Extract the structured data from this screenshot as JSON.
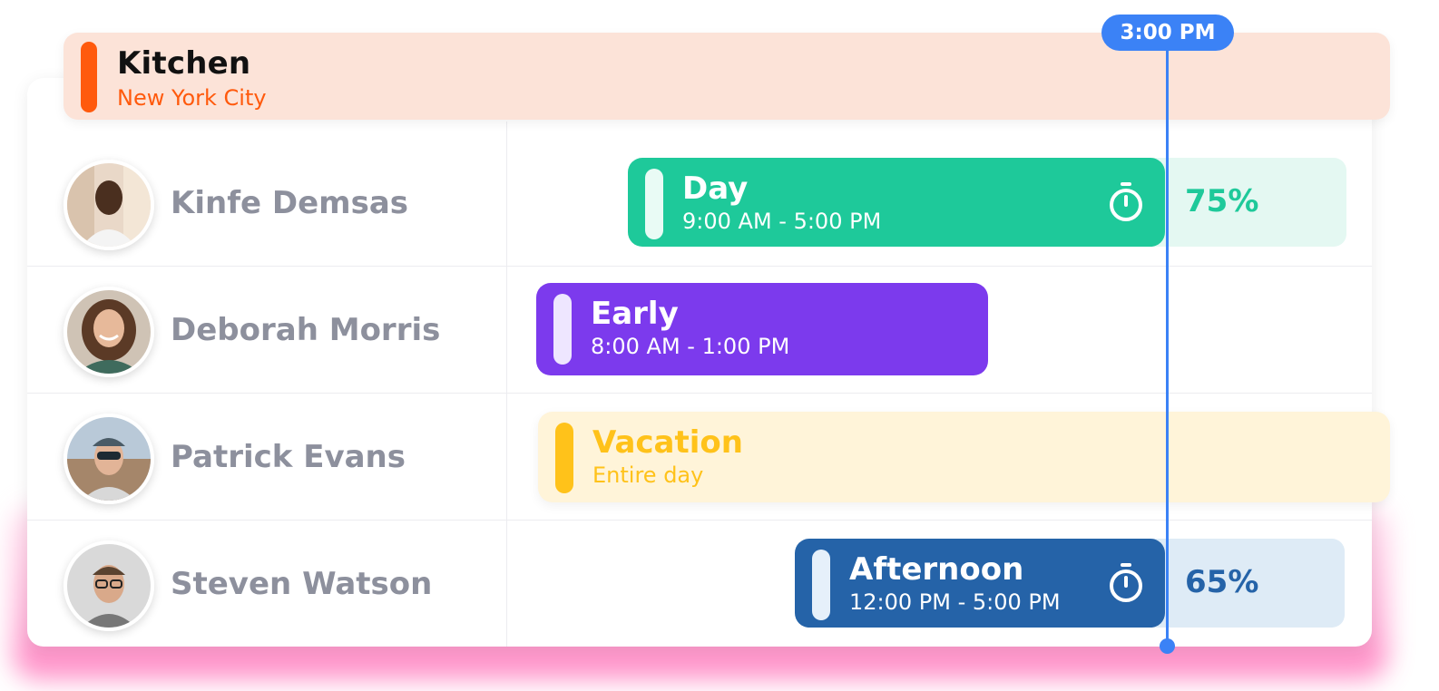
{
  "location": {
    "name": "Kitchen",
    "city": "New York City"
  },
  "current_time": "3:00 PM",
  "employees": [
    {
      "name": "Kinfe Demsas",
      "shift": {
        "label": "Day",
        "time": "9:00 AM - 5:00 PM",
        "progress": "75%",
        "color": "#1ec99a"
      }
    },
    {
      "name": "Deborah Morris",
      "shift": {
        "label": "Early",
        "time": "8:00 AM - 1:00 PM",
        "color": "#7c3aed"
      }
    },
    {
      "name": "Patrick Evans",
      "shift": {
        "label": "Vacation",
        "time": "Entire day",
        "color": "#ffc21a"
      }
    },
    {
      "name": "Steven Watson",
      "shift": {
        "label": "Afternoon",
        "time": "12:00 PM - 5:00 PM",
        "progress": "65%",
        "color": "#2563a8"
      }
    }
  ],
  "icons": {
    "timer": "stopwatch-icon"
  }
}
